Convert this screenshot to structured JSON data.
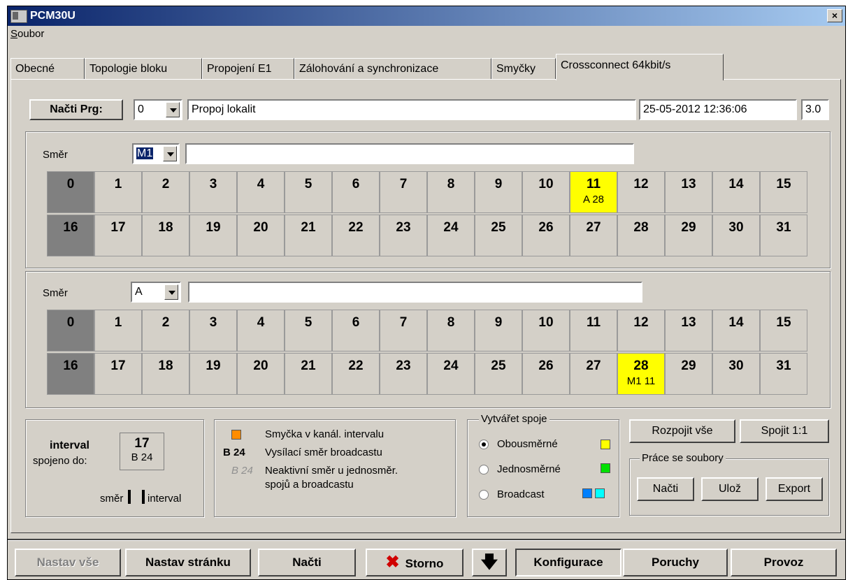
{
  "window": {
    "title": "PCM30U",
    "close_label": "×"
  },
  "menu": [
    {
      "label": "Soubor"
    }
  ],
  "tabs": [
    "Obecné",
    "Topologie bloku",
    "Propojení E1",
    "Zálohování a synchronizace",
    "Smyčky",
    "Crossconnect 64kbit/s"
  ],
  "toolbar": {
    "load_prg_label": "Načti Prg:",
    "prg_select": "0",
    "prg_name": "Propoj lokalit",
    "datetime": "25-05-2012 12:36:06",
    "version": "3.0"
  },
  "direction1": {
    "label": "Směr",
    "select": "M1",
    "name": "",
    "row1": [
      {
        "n": "0"
      },
      {
        "n": "1"
      },
      {
        "n": "2"
      },
      {
        "n": "3"
      },
      {
        "n": "4"
      },
      {
        "n": "5"
      },
      {
        "n": "6"
      },
      {
        "n": "7"
      },
      {
        "n": "8"
      },
      {
        "n": "9"
      },
      {
        "n": "10"
      },
      {
        "n": "11",
        "sub": "A  28"
      },
      {
        "n": "12"
      },
      {
        "n": "13"
      },
      {
        "n": "14"
      },
      {
        "n": "15"
      }
    ],
    "row2": [
      {
        "n": "16"
      },
      {
        "n": "17"
      },
      {
        "n": "18"
      },
      {
        "n": "19"
      },
      {
        "n": "20"
      },
      {
        "n": "21"
      },
      {
        "n": "22"
      },
      {
        "n": "23"
      },
      {
        "n": "24"
      },
      {
        "n": "25"
      },
      {
        "n": "26"
      },
      {
        "n": "27"
      },
      {
        "n": "28"
      },
      {
        "n": "29"
      },
      {
        "n": "30"
      },
      {
        "n": "31"
      }
    ]
  },
  "direction2": {
    "label": "Směr",
    "select": "A",
    "name": "",
    "row1": [
      {
        "n": "0"
      },
      {
        "n": "1"
      },
      {
        "n": "2"
      },
      {
        "n": "3"
      },
      {
        "n": "4"
      },
      {
        "n": "5"
      },
      {
        "n": "6"
      },
      {
        "n": "7"
      },
      {
        "n": "8"
      },
      {
        "n": "9"
      },
      {
        "n": "10"
      },
      {
        "n": "11"
      },
      {
        "n": "12"
      },
      {
        "n": "13"
      },
      {
        "n": "14"
      },
      {
        "n": "15"
      }
    ],
    "row2": [
      {
        "n": "16"
      },
      {
        "n": "17"
      },
      {
        "n": "18"
      },
      {
        "n": "19"
      },
      {
        "n": "20"
      },
      {
        "n": "21"
      },
      {
        "n": "22"
      },
      {
        "n": "23"
      },
      {
        "n": "24"
      },
      {
        "n": "25"
      },
      {
        "n": "26"
      },
      {
        "n": "27"
      },
      {
        "n": "28",
        "sub": "M1 11"
      },
      {
        "n": "29"
      },
      {
        "n": "30"
      },
      {
        "n": "31"
      }
    ]
  },
  "cell_colors": {
    "dark": "#808080",
    "highlight": "#ffff00",
    "normal": "#d4d0c8"
  },
  "interval_box": {
    "interval_label": "interval",
    "interval_value": "17",
    "connected_label": "spojeno do:",
    "connected_value": "B 24",
    "dir_label": "směr",
    "interval_label2": "interval"
  },
  "legend": {
    "item1": "Smyčka v kanál. intervalu",
    "item2_code": "B 24",
    "item2": "Vysílací směr broadcastu",
    "item3_code": "B 24",
    "item3_line1": "Neaktivní směr u jednosměr.",
    "item3_line2": "spojů a broadcastu",
    "item1_color": "#ff8c00"
  },
  "create": {
    "title": "Vytvářet spoje",
    "opt1": "Obousměrné",
    "opt2": "Jednosměrné",
    "opt3": "Broadcast",
    "opt1_color": "#ffff00",
    "opt2_color": "#00e000",
    "opt3_color_a": "#0080ff",
    "opt3_color_b": "#00ffff",
    "selected": "Obousměrné"
  },
  "actions": {
    "disconnect_all": "Rozpojit vše",
    "connect_1to1": "Spojit 1:1"
  },
  "files": {
    "title": "Práce se soubory",
    "load": "Načti",
    "save": "Ulož",
    "export": "Export"
  },
  "bottom": {
    "set_all": "Nastav vše",
    "set_page": "Nastav stránku",
    "load": "Načti",
    "cancel": "Storno",
    "config": "Konfigurace",
    "faults": "Poruchy",
    "operation": "Provoz"
  }
}
